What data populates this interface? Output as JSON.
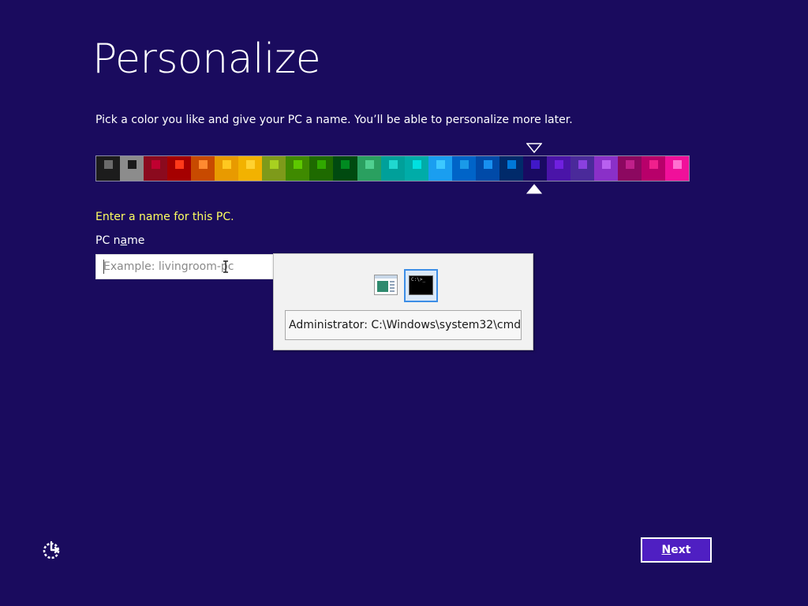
{
  "page": {
    "title": "Personalize",
    "subtitle": "Pick a color you like and give your PC a name. You’ll be able to personalize more later.",
    "background": "#1a0b5e"
  },
  "color_picker": {
    "selected_index": 18,
    "swatches": [
      {
        "bg": "#1c1c1c",
        "accent": "#6b6b6b"
      },
      {
        "bg": "#8c8c8c",
        "accent": "#1a1a1a"
      },
      {
        "bg": "#8b0a1e",
        "accent": "#c00030"
      },
      {
        "bg": "#a50000",
        "accent": "#ff3a1a"
      },
      {
        "bg": "#c84a00",
        "accent": "#ff8a30"
      },
      {
        "bg": "#e89a00",
        "accent": "#ffc820"
      },
      {
        "bg": "#f2b200",
        "accent": "#ffd230"
      },
      {
        "bg": "#7e9a1a",
        "accent": "#a8d020"
      },
      {
        "bg": "#3f8a00",
        "accent": "#5ec800"
      },
      {
        "bg": "#1e6a00",
        "accent": "#30a800"
      },
      {
        "bg": "#004a10",
        "accent": "#008a20"
      },
      {
        "bg": "#2aa060",
        "accent": "#50d090"
      },
      {
        "bg": "#00a09a",
        "accent": "#20d8cf"
      },
      {
        "bg": "#00aca8",
        "accent": "#00e0e0"
      },
      {
        "bg": "#1a9ef0",
        "accent": "#3cc8ff"
      },
      {
        "bg": "#0064c8",
        "accent": "#1a9ae8"
      },
      {
        "bg": "#004aa8",
        "accent": "#1890f0"
      },
      {
        "bg": "#002a6a",
        "accent": "#0078d8"
      },
      {
        "bg": "#190a62",
        "accent": "#4018c8"
      },
      {
        "bg": "#4a14a8",
        "accent": "#7020e0"
      },
      {
        "bg": "#4a2a9a",
        "accent": "#8a40e0"
      },
      {
        "bg": "#8a30c8",
        "accent": "#b860f0"
      },
      {
        "bg": "#8c0860",
        "accent": "#c0208a"
      },
      {
        "bg": "#b8006a",
        "accent": "#f0208c"
      },
      {
        "bg": "#f0109a",
        "accent": "#ff70d0"
      }
    ]
  },
  "form": {
    "prompt": "Enter a name for this PC.",
    "field_label": "PC name",
    "field_label_access_key": "a",
    "input_placeholder": "Example: livingroom-pc",
    "input_value": ""
  },
  "app_switcher": {
    "windows": [
      {
        "icon": "setup-window-icon",
        "selected": false
      },
      {
        "icon": "command-prompt-icon",
        "selected": true,
        "thumb_text": "C:\\>_"
      }
    ],
    "selected_caption": "Administrator: C:\\Windows\\system32\\cmd...."
  },
  "footer": {
    "ease_of_access_icon": "ease-of-access-icon",
    "next_label_underlined": "N",
    "next_label_rest": "ext"
  }
}
